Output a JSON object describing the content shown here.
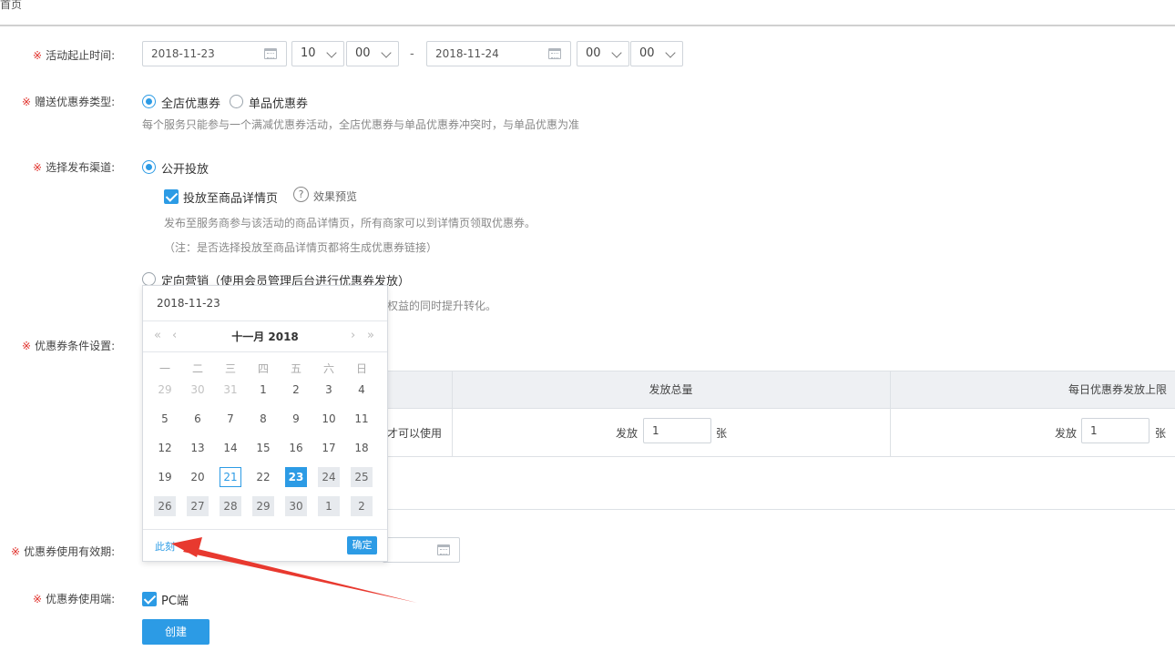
{
  "header": {
    "home": "首页"
  },
  "activity_time": {
    "label": "活动起止时间:",
    "start_date": "2018-11-23",
    "start_hour": "10",
    "start_minute": "00",
    "dash": "-",
    "end_date": "2018-11-24",
    "end_hour": "00",
    "end_minute": "00"
  },
  "coupon_type": {
    "label": "赠送优惠券类型:",
    "option_all": "全店优惠券",
    "option_single": "单品优惠券",
    "hint": "每个服务只能参与一个满减优惠券活动，全店优惠券与单品优惠券冲突时，与单品优惠为准"
  },
  "channel": {
    "label": "选择发布渠道:",
    "public": "公开投放",
    "detail_page_checkbox": "投放至商品详情页",
    "preview": "效果预览",
    "hint1": "发布至服务商参与该活动的商品详情页，所有商家可以到详情页领取优惠券。",
    "hint2": "（注：是否选择投放至商品详情页都将生成优惠券链接）",
    "targeted": "定向营销（使用会员管理后台进行优惠券发放）",
    "targeted_hint_tail": "权益的同时提升转化。"
  },
  "conditions": {
    "label": "优惠券条件设置:",
    "col_total": "发放总量",
    "col_daily": "每日优惠券发放上限",
    "row_left_tail": "才可以使用",
    "issue_label": "发放",
    "total_value": "1",
    "daily_value": "1",
    "unit": "张"
  },
  "validity": {
    "label": "优惠券使用有效期:"
  },
  "platform": {
    "label": "优惠券使用端:",
    "pc": "PC端"
  },
  "create_button": "创建",
  "datepicker": {
    "current": "2018-11-23",
    "title": "十一月  2018",
    "weekdays": [
      "一",
      "二",
      "三",
      "四",
      "五",
      "六",
      "日"
    ],
    "weeks": [
      [
        "29",
        "30",
        "31",
        "1",
        "2",
        "3",
        "4"
      ],
      [
        "5",
        "6",
        "7",
        "8",
        "9",
        "10",
        "11"
      ],
      [
        "12",
        "13",
        "14",
        "15",
        "16",
        "17",
        "18"
      ],
      [
        "19",
        "20",
        "21",
        "22",
        "23",
        "24",
        "25"
      ],
      [
        "26",
        "27",
        "28",
        "29",
        "30",
        "1",
        "2"
      ]
    ],
    "now": "此刻",
    "ok": "确定"
  },
  "colors": {
    "accent": "#2c9be5",
    "required": "#e0312b",
    "annotation_arrow": "#e8392f"
  }
}
